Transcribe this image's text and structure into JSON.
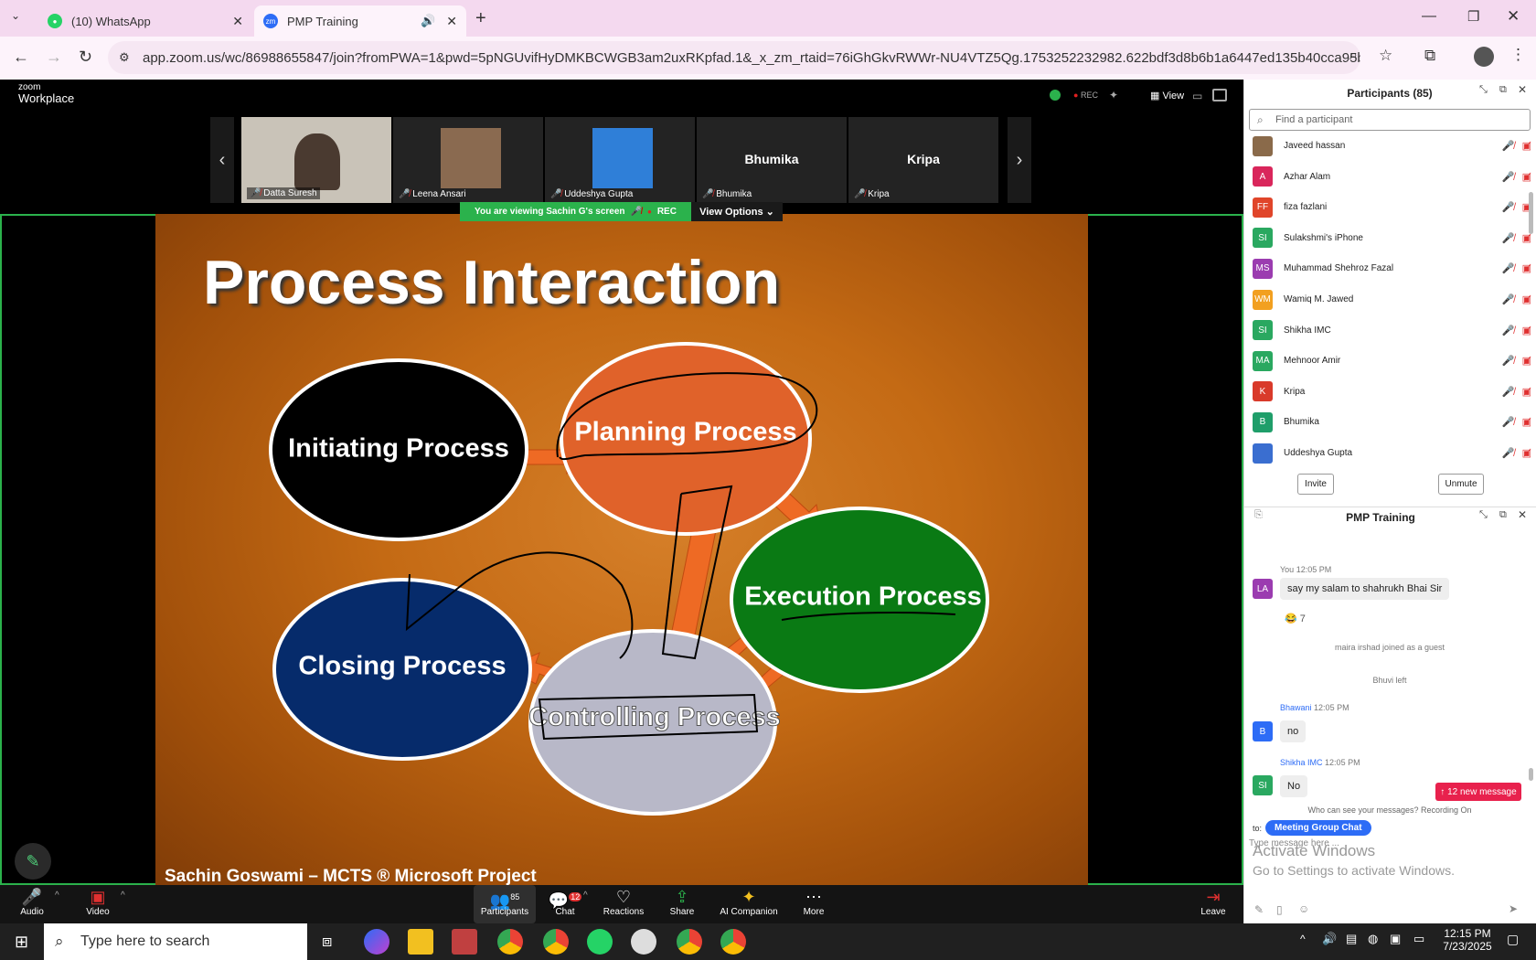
{
  "browser": {
    "tabs": [
      {
        "label": "(10) WhatsApp"
      },
      {
        "label": "PMP Training"
      }
    ],
    "url": "app.zoom.us/wc/86988655847/join?fromPWA=1&pwd=5pNGUvifHyDMKBCWGB3am2uxRKpfad.1&_x_zm_rtaid=76iGhGkvRWWr-NU4VTZ5Qg.1753252232982.622bdf3d8b6b1a6447ed135b40cca95b&_x_zm_rht..."
  },
  "zoom": {
    "logo_top": "zoom",
    "logo_bottom": "Workplace",
    "rec": "REC",
    "view": "View"
  },
  "videos": [
    {
      "name": "Datta Suresh"
    },
    {
      "name": "Leena Ansari"
    },
    {
      "name": "Uddeshya Gupta"
    },
    {
      "name": "Bhumika",
      "big": "Bhumika"
    },
    {
      "name": "Kripa",
      "big": "Kripa"
    }
  ],
  "banner": {
    "text": "You are viewing Sachin G's screen",
    "rec": "REC",
    "view_options": "View Options"
  },
  "slide": {
    "title": "Process Interaction",
    "footer": "Sachin Goswami – MCTS ® Microsoft Project",
    "ellipses": [
      {
        "label": "Initiating Process",
        "color": "#000000"
      },
      {
        "label": "Planning Process",
        "color": "#e0622a"
      },
      {
        "label": "Execution Process",
        "color": "#0a7a14"
      },
      {
        "label": "Closing Process",
        "color": "#062b6b"
      },
      {
        "label": "Controlling Process",
        "color": "#b8b8c8"
      }
    ]
  },
  "toolbar": {
    "audio": "Audio",
    "video": "Video",
    "participants": "Participants",
    "participants_count": "85",
    "chat": "Chat",
    "chat_badge": "12",
    "reactions": "Reactions",
    "share": "Share",
    "ai": "AI Companion",
    "more": "More",
    "leave": "Leave"
  },
  "participants": {
    "title": "Participants (85)",
    "search_placeholder": "Find a participant",
    "list": [
      {
        "name": "Javeed hassan",
        "initials": "",
        "color": "#8a6a4a"
      },
      {
        "name": "Azhar Alam",
        "initials": "A",
        "color": "#d9265b"
      },
      {
        "name": "fiza fazlani",
        "initials": "FF",
        "color": "#e0452a"
      },
      {
        "name": "Sulakshmi's iPhone",
        "initials": "SI",
        "color": "#2aa860"
      },
      {
        "name": "Muhammad Shehroz Fazal",
        "initials": "MS",
        "color": "#9b3cb0"
      },
      {
        "name": "Wamiq M. Jawed",
        "initials": "WM",
        "color": "#f2a020"
      },
      {
        "name": "Shikha IMC",
        "initials": "SI",
        "color": "#2aa860"
      },
      {
        "name": "Mehnoor Amir",
        "initials": "MA",
        "color": "#2aa860"
      },
      {
        "name": "Kripa",
        "initials": "K",
        "color": "#d93a2a"
      },
      {
        "name": "Bhumika",
        "initials": "B",
        "color": "#1f9e6a"
      },
      {
        "name": "Uddeshya Gupta",
        "initials": "",
        "color": "#3a6ed0"
      }
    ],
    "invite": "Invite",
    "unmute": "Unmute"
  },
  "chat": {
    "title": "PMP Training",
    "you_meta": "You  12:05 PM",
    "you_msg": "say my salam to shahrukh Bhai Sir",
    "you_initials": "LA",
    "emoji": "😂 7",
    "sys1": "maira irshad joined as a guest",
    "sys2": "Bhuvi left",
    "m1_name": "Bhawani",
    "m1_time": "12:05 PM",
    "m1_initials": "B",
    "m1_text": "no",
    "m2_name": "Shikha IMC",
    "m2_time": "12:05 PM",
    "m2_initials": "SI",
    "m2_text": "No",
    "new_msg": "↑ 12 new message",
    "visibility": "Who can see your messages? Recording On",
    "to_label": "to:",
    "to_value": "Meeting Group Chat",
    "input_placeholder": "Type message here ...",
    "watermark1": "Activate Windows",
    "watermark2": "Go to Settings to activate Windows."
  },
  "taskbar": {
    "search": "Type here to search",
    "time": "12:15 PM",
    "date": "7/23/2025"
  }
}
